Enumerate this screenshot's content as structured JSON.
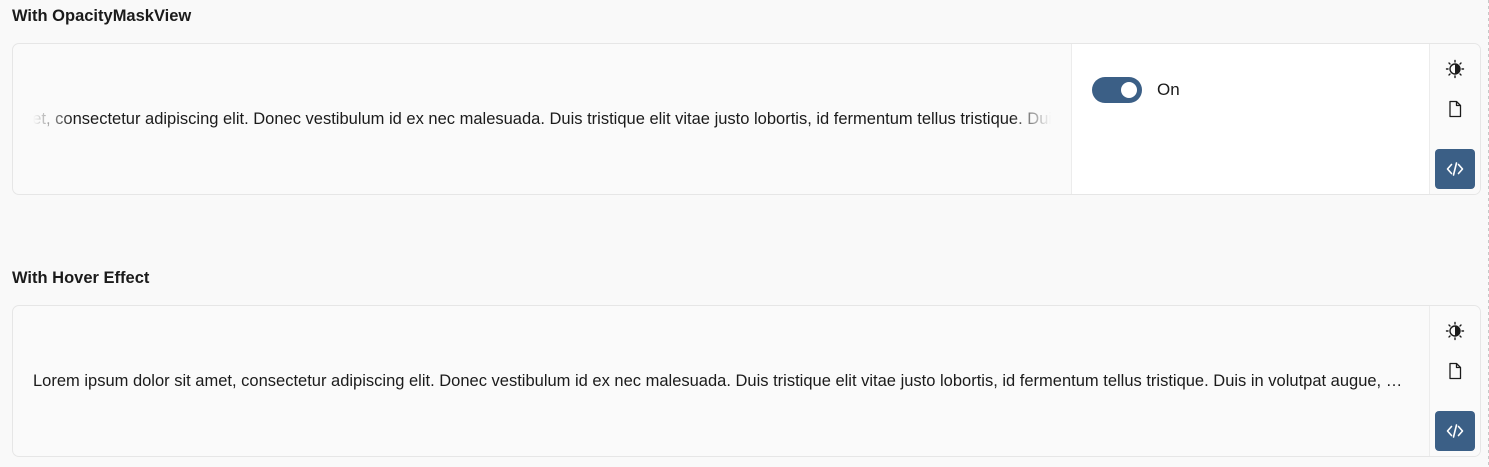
{
  "sections": [
    {
      "title": "With OpacityMaskView",
      "preview_text": "Lorem ipsum dolor sit amet, consectetur adipiscing elit. Donec vestibulum id ex nec malesuada. Duis tristique elit vitae justo lobortis, id fermentum tellus tristique. Duis in volutpat augue, a blandit enim. Suspendisse a dolor tempor, commodo metus",
      "toggle": {
        "label": "On",
        "checked": true
      }
    },
    {
      "title": "With Hover Effect",
      "preview_text": "Lorem ipsum dolor sit amet, consectetur adipiscing elit. Donec vestibulum id ex nec malesuada. Duis tristique elit vitae justo lobortis, id fermentum tellus tristique. Duis in volutpat augue, a blandit enim."
    }
  ],
  "toolbar_icons": [
    "theme-toggle-icon",
    "document-icon",
    "code-icon"
  ],
  "colors": {
    "accent": "#3b5f86",
    "page_bg": "#f9f9f9",
    "card_bg": "#fafafa"
  }
}
